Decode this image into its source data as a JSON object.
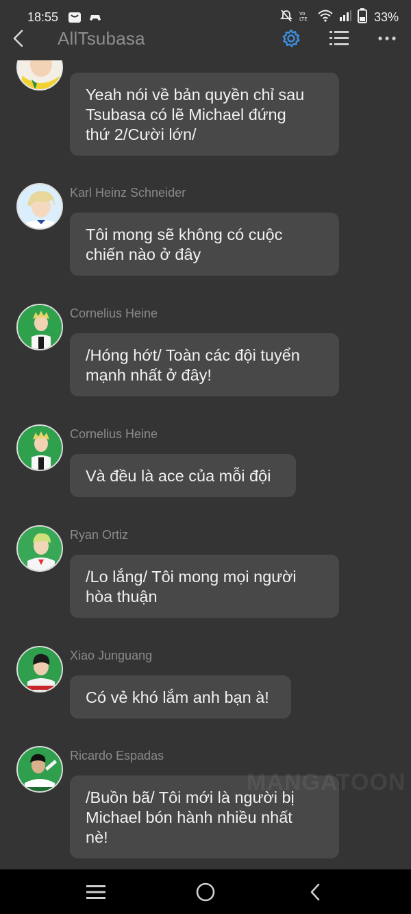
{
  "status_bar": {
    "time": "18:55",
    "battery_percent": "33%",
    "icons": [
      "notification-icon",
      "gamepad-icon",
      "mute-icon",
      "volte-icon",
      "wifi-icon",
      "signal-icon",
      "battery-icon"
    ]
  },
  "header": {
    "title": "AllTsubasa",
    "icons": [
      "back-icon",
      "gear-icon",
      "list-icon",
      "more-icon"
    ],
    "accent_color": "#3d8fe0"
  },
  "messages": [
    {
      "sender": "",
      "avatar": "avatar-yellow-jersey",
      "text_lines": [
        "Yeah nói về bản quyền chỉ sau",
        "Tsubasa có lẽ Michael đứng",
        "thứ 2/Cười lớn/"
      ]
    },
    {
      "sender": "Karl Heinz Schneider",
      "avatar": "avatar-karl-heinz-schneider",
      "text_lines": [
        "Tôi mong sẽ không có cuộc",
        "chiến nào ở đây"
      ]
    },
    {
      "sender": "Cornelius Heine",
      "avatar": "avatar-cornelius-heine",
      "text_lines": [
        "/Hóng hớt/ Toàn các đội tuyển",
        "mạnh nhất ở đây!"
      ]
    },
    {
      "sender": "Cornelius Heine",
      "avatar": "avatar-cornelius-heine",
      "text_lines": [
        "Và đều là ace của mỗi đội"
      ]
    },
    {
      "sender": "Ryan Ortiz",
      "avatar": "avatar-ryan-ortiz",
      "text_lines": [
        "/Lo lắng/ Tôi mong mọi người",
        "hòa thuận"
      ]
    },
    {
      "sender": "Xiao Junguang",
      "avatar": "avatar-xiao-junguang",
      "text_lines": [
        "Có vẻ khó lắm anh bạn à!"
      ]
    },
    {
      "sender": "Ricardo Espadas",
      "avatar": "avatar-ricardo-espadas",
      "text_lines": [
        "/Buồn bã/ Tôi mới là người bị",
        "Michael bón hành nhiều nhất",
        "nè!"
      ]
    }
  ],
  "watermark": "MANGATOON",
  "nav_bar": {
    "icons": [
      "menu-icon",
      "home-icon",
      "back-nav-icon"
    ]
  }
}
